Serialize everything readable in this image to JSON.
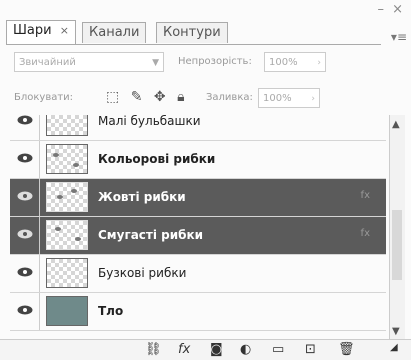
{
  "window": {
    "controls": "– ×",
    "panel_menu": "▾≡"
  },
  "tabs": [
    {
      "label": "Шари",
      "close": "×",
      "active": true
    },
    {
      "label": "Канали",
      "active": false
    },
    {
      "label": "Контури",
      "active": false
    }
  ],
  "blend": {
    "value": "Звичайний",
    "opacity_label": "Непрозорість:",
    "opacity_value": "100%"
  },
  "lock": {
    "label": "Блокувати:",
    "fill_label": "Заливка:",
    "fill_value": "100%"
  },
  "layers": [
    {
      "name": "Малі бульбашки",
      "selected": false,
      "bold": false
    },
    {
      "name": "Кольорові рибки",
      "selected": false,
      "bold": true
    },
    {
      "name": "Жовті рибки",
      "selected": true,
      "bold": true,
      "fx": "fx"
    },
    {
      "name": "Смугасті рибки",
      "selected": true,
      "bold": true,
      "fx": "fx"
    },
    {
      "name": "Бузкові рибки",
      "selected": false,
      "bold": false
    },
    {
      "name": "Тло",
      "selected": false,
      "bold": true
    }
  ],
  "icons": {
    "link": "link-icon",
    "fx": "fx-icon",
    "mask": "mask-icon",
    "adjust": "adjustment-icon",
    "group": "folder-icon",
    "new": "new-layer-icon",
    "delete": "trash-icon",
    "resize": "resize-grip-icon"
  },
  "colors": {
    "selected_row": "#5b5b5b",
    "panel_bg": "#fbfbfb"
  }
}
